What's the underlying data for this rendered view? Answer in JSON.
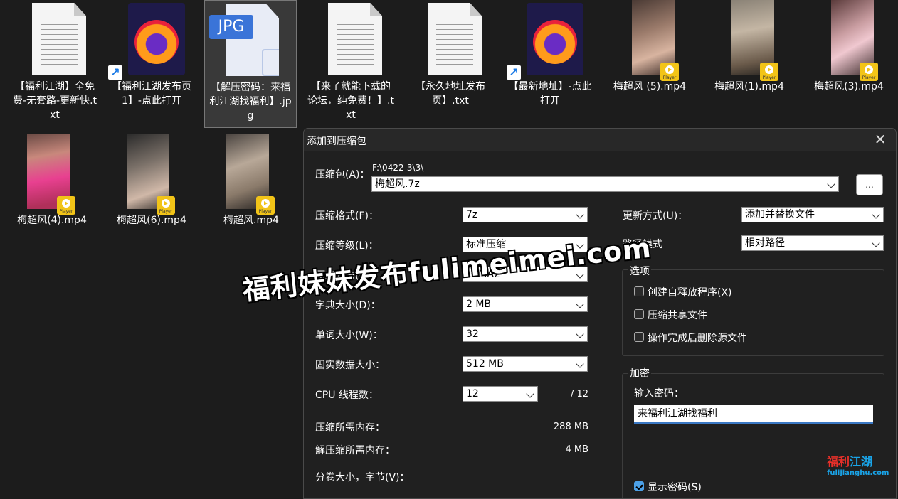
{
  "files": [
    {
      "name": "【福利江湖】全免费-无套路-更新快.txt",
      "type": "txt"
    },
    {
      "name": "【福利江湖发布页1】-点此打开",
      "type": "firefox-shortcut"
    },
    {
      "name": "【解压密码：来福利江湖找福利】.jpg",
      "type": "jpg",
      "icon_label": "JPG"
    },
    {
      "name": "【来了就能下载的论坛，纯免费！】.txt",
      "type": "txt"
    },
    {
      "name": "【永久地址发布页】.txt",
      "type": "txt"
    },
    {
      "name": "【最新地址】-点此打开",
      "type": "firefox-shortcut"
    },
    {
      "name": "梅超风 (5).mp4",
      "type": "mp4"
    },
    {
      "name": "梅超风(1).mp4",
      "type": "mp4"
    },
    {
      "name": "梅超风(3).mp4",
      "type": "mp4"
    },
    {
      "name": "梅超风(4).mp4",
      "type": "mp4"
    },
    {
      "name": "梅超风(6).mp4",
      "type": "mp4"
    },
    {
      "name": "梅超风.mp4",
      "type": "mp4"
    }
  ],
  "player_badge": "Player",
  "dialog": {
    "title": "添加到压缩包",
    "close_glyph": "✕",
    "archive_label": "压缩包(A)：",
    "archive_path": "F:\\0422-3\\3\\",
    "archive_name": "梅超风.7z",
    "browse_label": "...",
    "format_label": "压缩格式(F)：",
    "format_value": "7z",
    "level_label": "压缩等级(L)：",
    "level_value": "标准压缩",
    "method_label": "压缩方法(M)：",
    "method_value": "LZMA2",
    "dict_label": "字典大小(D)：",
    "dict_value": "2 MB",
    "word_label": "单词大小(W)：",
    "word_value": "32",
    "solid_label": "固实数据大小：",
    "solid_value": "512 MB",
    "cpu_label": "CPU 线程数：",
    "cpu_value": "12",
    "cpu_total": "/ 12",
    "mem_comp_label": "压缩所需内存：",
    "mem_comp_value": "288 MB",
    "mem_decomp_label": "解压缩所需内存：",
    "mem_decomp_value": "4 MB",
    "volume_label": "分卷大小，字节(V)：",
    "update_label": "更新方式(U)：",
    "update_value": "添加并替换文件",
    "path_label": "路径模式",
    "path_value": "相对路径",
    "options_title": "选项",
    "opt_sfx": "创建自释放程序(X)",
    "opt_shared": "压缩共享文件",
    "opt_delete": "操作完成后删除源文件",
    "encrypt_title": "加密",
    "password_label": "输入密码：",
    "password_value": "来福利江湖找福利",
    "show_password": "显示密码(S)"
  },
  "watermark": "福利妹妹发布fulimeimei.com",
  "logo": {
    "line1_a": "福利",
    "line1_b": "江湖",
    "line2": "fulijianghu.com"
  }
}
